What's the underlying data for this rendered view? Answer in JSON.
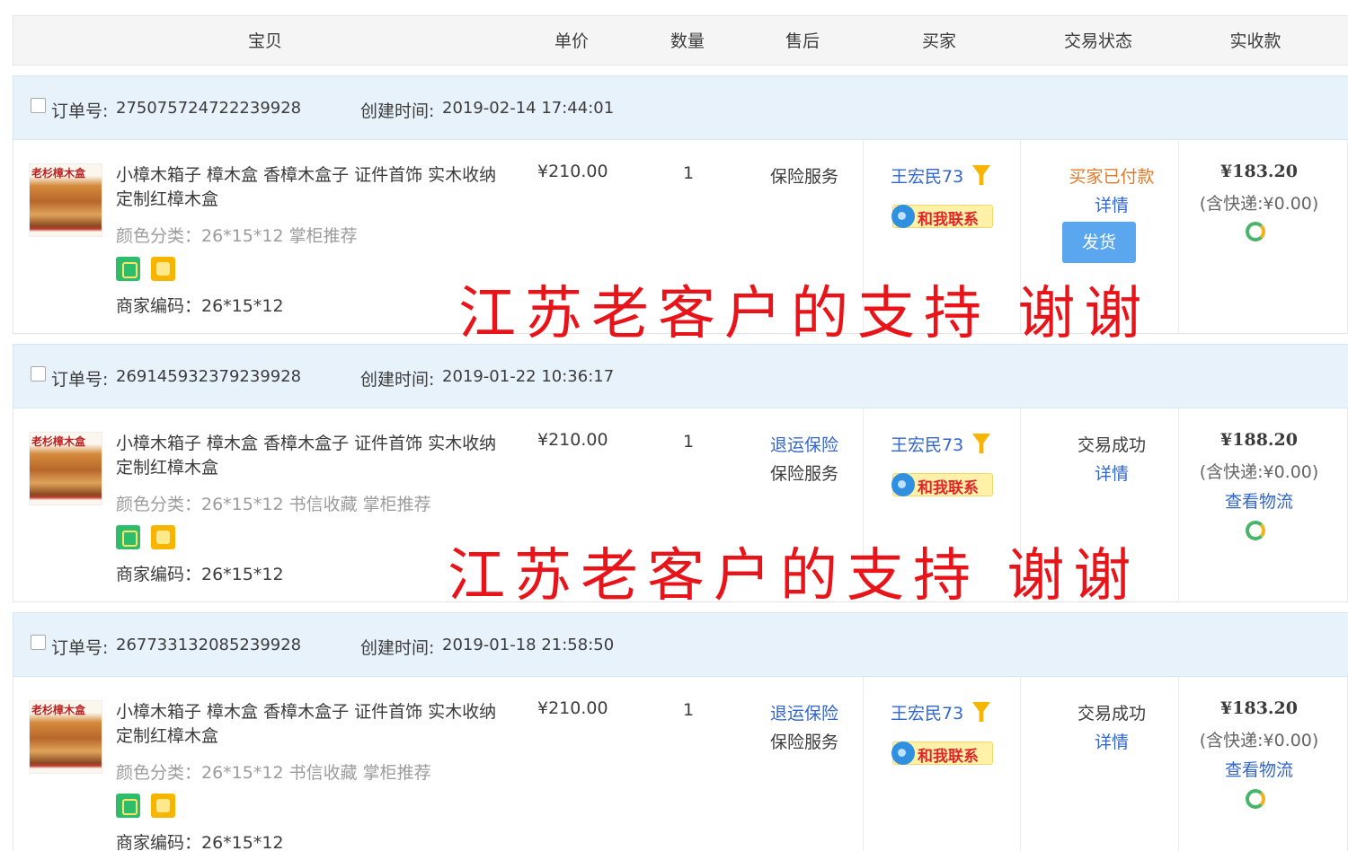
{
  "header": {
    "columns": [
      "宝贝",
      "单价",
      "数量",
      "售后",
      "买家",
      "交易状态",
      "实收款"
    ]
  },
  "labels": {
    "order_no": "订单号:",
    "created": "创建时间:",
    "details": "详情",
    "ship": "发货",
    "contact": "和我联系",
    "logistics": "查看物流",
    "thumb_logo": "老杉樟木盒"
  },
  "orders": [
    {
      "order_no": "275075724722239928",
      "created": "2019-02-14 17:44:01",
      "title": "小樟木箱子 樟木盒 香樟木盒子 证件首饰 实木收纳定制红樟木盒",
      "sku": "颜色分类：26*15*12 掌柜推荐",
      "merchant": "商家编码：26*15*12",
      "price": "¥210.00",
      "qty": "1",
      "after_sales": [
        "保险服务"
      ],
      "buyer": "王宏民73",
      "status": "买家已付款",
      "amount": "¥183.20",
      "shipping": "(含快递:¥0.00)",
      "overlay": "江苏老客户的支持 谢谢"
    },
    {
      "order_no": "269145932379239928",
      "created": "2019-01-22 10:36:17",
      "title": "小樟木箱子 樟木盒 香樟木盒子 证件首饰 实木收纳定制红樟木盒",
      "sku": "颜色分类：26*15*12 书信收藏 掌柜推荐",
      "merchant": "商家编码：26*15*12",
      "price": "¥210.00",
      "qty": "1",
      "after_sales": [
        "退运保险",
        "保险服务"
      ],
      "buyer": "王宏民73",
      "status": "交易成功",
      "amount": "¥188.20",
      "shipping": "(含快递:¥0.00)",
      "overlay": "江苏老客户的支持 谢谢"
    },
    {
      "order_no": "267733132085239928",
      "created": "2019-01-18 21:58:50",
      "title": "小樟木箱子 樟木盒 香樟木盒子 证件首饰 实木收纳定制红樟木盒",
      "sku": "颜色分类：26*15*12 书信收藏 掌柜推荐",
      "merchant": "商家编码：26*15*12",
      "price": "¥210.00",
      "qty": "1",
      "after_sales": [
        "退运保险",
        "保险服务"
      ],
      "buyer": "王宏民73",
      "status": "交易成功",
      "amount": "¥183.20",
      "shipping": "(含快递:¥0.00)"
    }
  ]
}
